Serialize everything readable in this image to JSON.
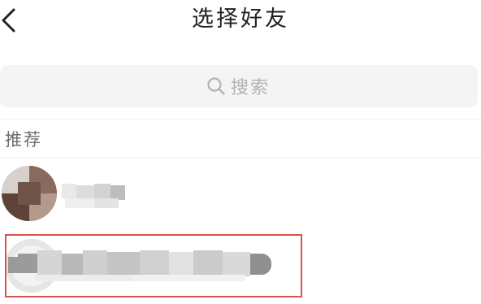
{
  "header": {
    "title": "选择好友",
    "back_icon": "chevron-left-icon"
  },
  "search": {
    "placeholder": "搜索",
    "icon": "search-icon"
  },
  "section": {
    "label": "推荐"
  },
  "friends": [
    {
      "avatar": "blurred",
      "name": "blurred",
      "selected": false
    },
    {
      "avatar": "blurred",
      "name": "blurred",
      "selected": true
    }
  ],
  "colors": {
    "background": "#ffffff",
    "search_bg": "#f4f4f4",
    "placeholder": "#b2b2b2",
    "section_label": "#6e6e6e",
    "highlight": "#d9534f"
  }
}
